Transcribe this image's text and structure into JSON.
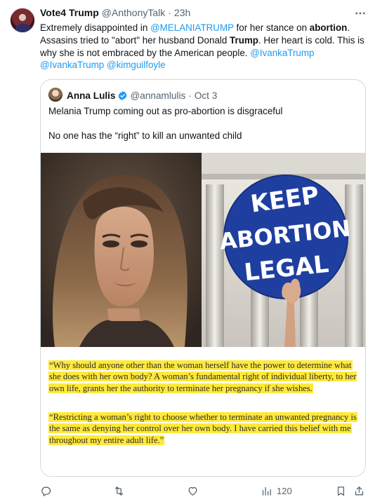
{
  "tweet": {
    "author_name": "Vote4 Trump",
    "author_handle": "@AnthonyTalk",
    "separator": "·",
    "time": "23h",
    "text": {
      "p1": "Extremely disappointed in ",
      "m1": "@MELANIATRUMP",
      "p2": " for her stance on ",
      "b1": "abortion",
      "p3": ". Assasins tried to \"abort\" her husband Donald ",
      "b2": "Trump",
      "p4": ".  Her heart is cold. This is why she is not embraced by the American people. ",
      "m2": "@IvankaTrump",
      "m3": "@IvankaTrump",
      "m4": "@kimguilfoyle"
    }
  },
  "quote": {
    "author_name": "Anna Lulis",
    "author_handle": "@annamlulis",
    "separator": "·",
    "time": "Oct 3",
    "line1": "Melania Trump coming out as pro-abortion is disgraceful",
    "line2": "No one has the “right” to kill an unwanted child",
    "sign_text": {
      "l1": "KEEP",
      "l2": "ABORTION",
      "l3": "LEGAL"
    },
    "quote_para1": "“Why should anyone other than the woman herself have the power to determine what she does with her own body? A woman’s fundamental right of individual liberty, to her own life, grants her the authority to terminate her pregnancy if she wishes.",
    "quote_para2": "“Restricting a woman’s right to choose whether to terminate an unwanted pregnancy is the same as denying her control over her own body. I have carried this belief with me throughout my entire adult life.”"
  },
  "actions": {
    "reply_icon": "reply-icon",
    "retweet_icon": "retweet-icon",
    "like_icon": "like-icon",
    "views_icon": "views-icon",
    "views_count": "120",
    "bookmark_icon": "bookmark-icon",
    "share_icon": "share-icon"
  },
  "colors": {
    "accent": "#1d9bf0",
    "highlight": "#ffe93b",
    "sign_blue": "#1f3fa0",
    "muted": "#536471"
  }
}
